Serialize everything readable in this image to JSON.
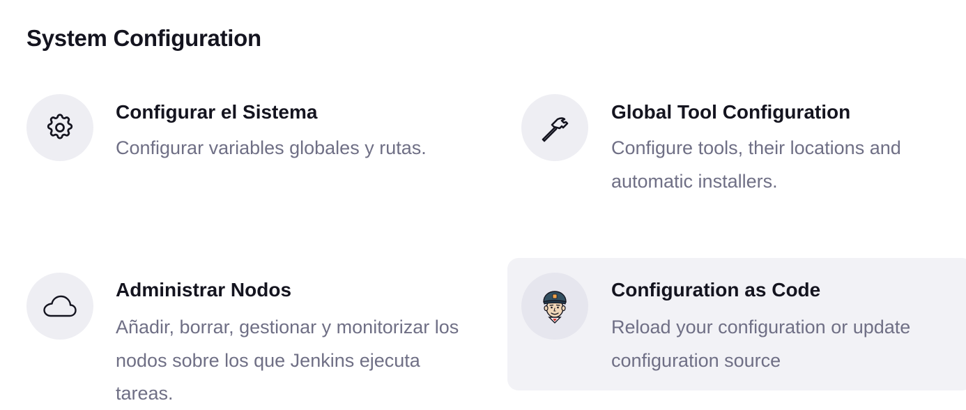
{
  "section": {
    "title": "System Configuration"
  },
  "cards": [
    {
      "title": "Configurar el Sistema",
      "description": "Configurar variables globales y rutas.",
      "icon": "gear-icon"
    },
    {
      "title": "Global Tool Configuration",
      "description": "Configure tools, their locations and automatic installers.",
      "icon": "hammer-icon"
    },
    {
      "title": "Administrar Nodos",
      "description": "Añadir, borrar, gestionar y monitorizar los nodos sobre los que Jenkins ejecuta tareas.",
      "icon": "cloud-icon"
    },
    {
      "title": "Configuration as Code",
      "description": "Reload your configuration or update configuration source",
      "icon": "jenkins-logo-icon"
    }
  ],
  "colors": {
    "text_primary": "#14141f",
    "text_secondary": "#6f6f85",
    "icon_background": "#eeeef3",
    "hover_background": "#f2f2f6"
  }
}
